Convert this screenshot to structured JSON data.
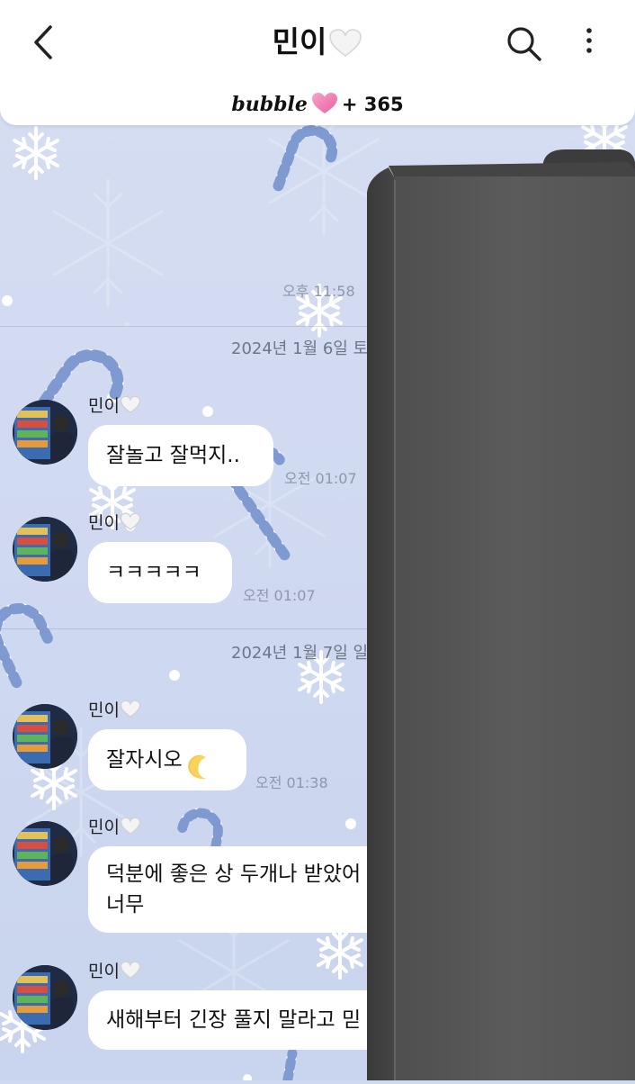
{
  "header": {
    "back_icon": "chevron-left-icon",
    "title": "민이",
    "title_icon": "white-heart-icon",
    "search_icon": "search-icon",
    "more_icon": "more-vertical-icon"
  },
  "subscription": {
    "logo": "bubble",
    "heart_icon": "pink-heart-icon",
    "days": "+ 365"
  },
  "chat": {
    "first_time": "오후 11:58",
    "day1": {
      "date": "2024년 1월 6일 토",
      "messages": [
        {
          "sender": "민이",
          "text": "잘놀고 잘먹지..",
          "time": "오전 01:07"
        },
        {
          "sender": "민이",
          "text": "ㅋㅋㅋㅋㅋ",
          "time": "오전 01:07"
        }
      ]
    },
    "day2": {
      "date": "2024년 1월 7일 일",
      "messages": [
        {
          "sender": "민이",
          "text": "잘자시오",
          "emoji": "crescent-moon-icon",
          "time": "오전 01:38"
        },
        {
          "sender": "민이",
          "line1": "덕분에 좋은 상 두개나 받았어",
          "line2": "너무"
        },
        {
          "sender": "민이",
          "text": "새해부터 긴장 풀지 말라고 믿"
        }
      ]
    }
  },
  "colors": {
    "background": "#cfd9ef",
    "header_bg": "#ffffff",
    "bubble_bg": "#ffffff",
    "pink_heart": "#f06eaa",
    "candy_stripe": "#7f9ad0",
    "occluder": "#555555"
  }
}
